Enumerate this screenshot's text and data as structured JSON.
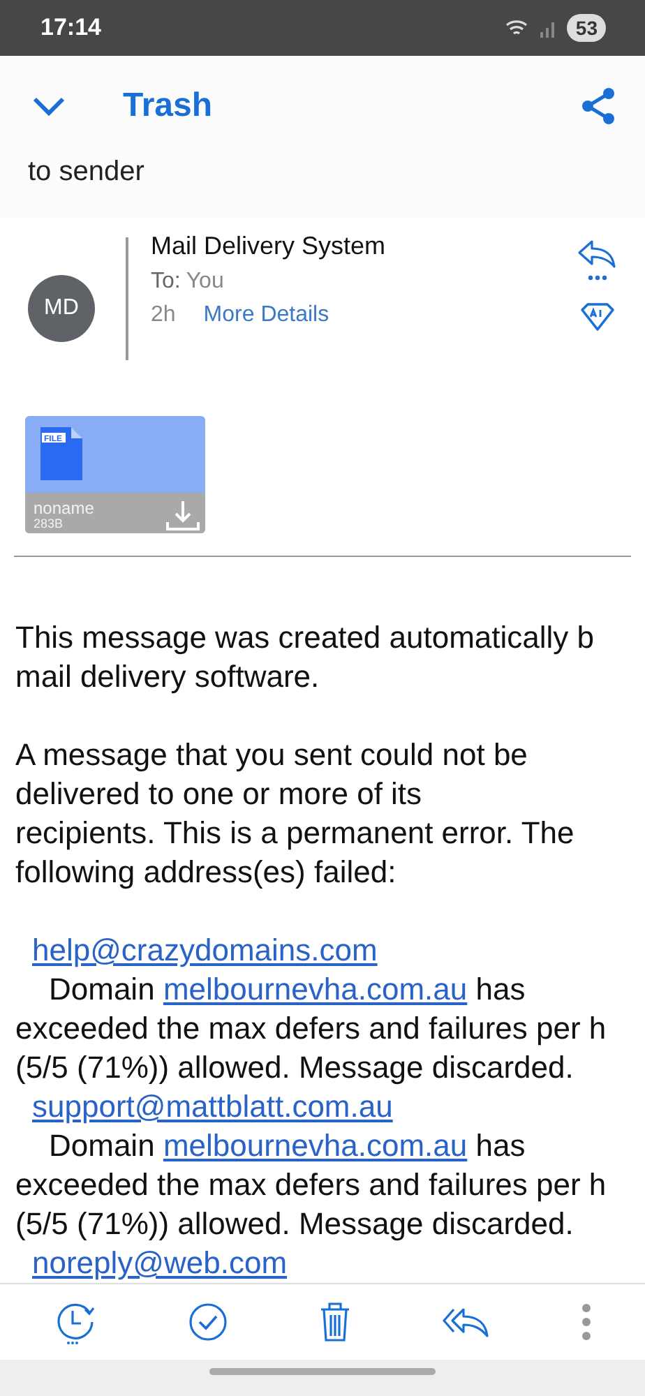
{
  "status_bar": {
    "time": "17:14",
    "battery": "53"
  },
  "header": {
    "title": "Trash"
  },
  "subject_tail": "to sender",
  "sender": {
    "initials": "MD",
    "name": "Mail Delivery System",
    "to_label": "To:",
    "to_value": "You",
    "age": "2h",
    "details_link": "More Details"
  },
  "attachment": {
    "badge": "FILE",
    "name": "noname",
    "size": "283B"
  },
  "body": [
    {
      "kind": "paragraph",
      "lines": [
        "This message was created automatically b",
        "mail delivery software."
      ]
    },
    {
      "kind": "paragraph",
      "lines": [
        "A message that you sent could not be",
        "delivered to one or more of its",
        "recipients. This is a permanent error. The",
        "following address(es) failed:"
      ]
    },
    {
      "kind": "failure",
      "address": "help@crazydomains.com",
      "prefix": "Domain",
      "domain": "melbournevha.com.au",
      "suffix": "has",
      "lines": [
        "exceeded the max defers and failures per h",
        "(5/5 (71%)) allowed. Message discarded."
      ]
    },
    {
      "kind": "failure",
      "address": "support@mattblatt.com.au",
      "prefix": "Domain",
      "domain": "melbournevha.com.au",
      "suffix": "has",
      "lines": [
        "exceeded the max defers and failures per h",
        "(5/5 (71%)) allowed. Message discarded."
      ]
    },
    {
      "kind": "address",
      "address": "noreply@web.com"
    }
  ]
}
